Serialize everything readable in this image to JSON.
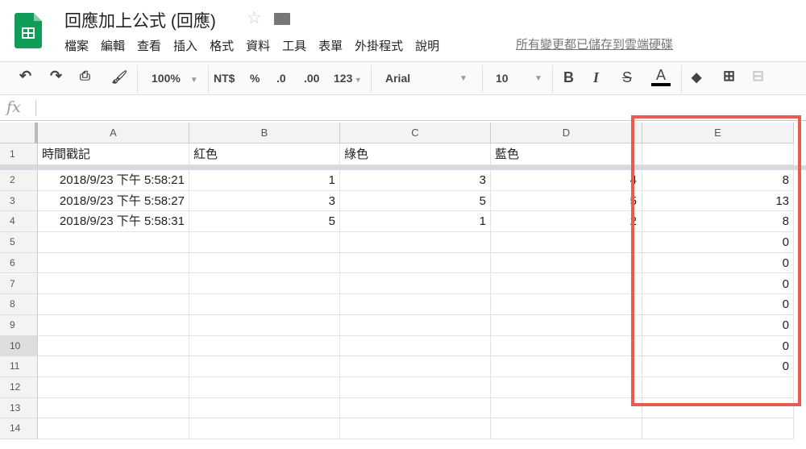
{
  "doc": {
    "title": "回應加上公式 (回應)",
    "saved_status": "所有變更都已儲存到雲端硬碟"
  },
  "menu": [
    "檔案",
    "編輯",
    "查看",
    "插入",
    "格式",
    "資料",
    "工具",
    "表單",
    "外掛程式",
    "說明"
  ],
  "toolbar": {
    "zoom": "100%",
    "currency": "NT$",
    "percent": "%",
    "dec_less": ".0",
    "dec_more": ".00",
    "format": "123",
    "font": "Arial",
    "size": "10",
    "bold": "B",
    "italic": "I",
    "strike": "S",
    "text_color": "A"
  },
  "formula": {
    "label": "fx",
    "value": ""
  },
  "columns": [
    "A",
    "B",
    "C",
    "D",
    "E"
  ],
  "rows": [
    [
      "時間戳記",
      "紅色",
      "綠色",
      "藍色",
      ""
    ],
    [
      "2018/9/23 下午 5:58:21",
      "1",
      "3",
      "4",
      "8"
    ],
    [
      "2018/9/23 下午 5:58:27",
      "3",
      "5",
      "5",
      "13"
    ],
    [
      "2018/9/23 下午 5:58:31",
      "5",
      "1",
      "2",
      "8"
    ],
    [
      "",
      "",
      "",
      "",
      "0"
    ],
    [
      "",
      "",
      "",
      "",
      "0"
    ],
    [
      "",
      "",
      "",
      "",
      "0"
    ],
    [
      "",
      "",
      "",
      "",
      "0"
    ],
    [
      "",
      "",
      "",
      "",
      "0"
    ],
    [
      "",
      "",
      "",
      "",
      "0"
    ],
    [
      "",
      "",
      "",
      "",
      "0"
    ],
    [
      "",
      "",
      "",
      "",
      ""
    ],
    [
      "",
      "",
      "",
      "",
      ""
    ],
    [
      "",
      "",
      "",
      "",
      ""
    ]
  ],
  "highlight_color": "#ea5a4f"
}
